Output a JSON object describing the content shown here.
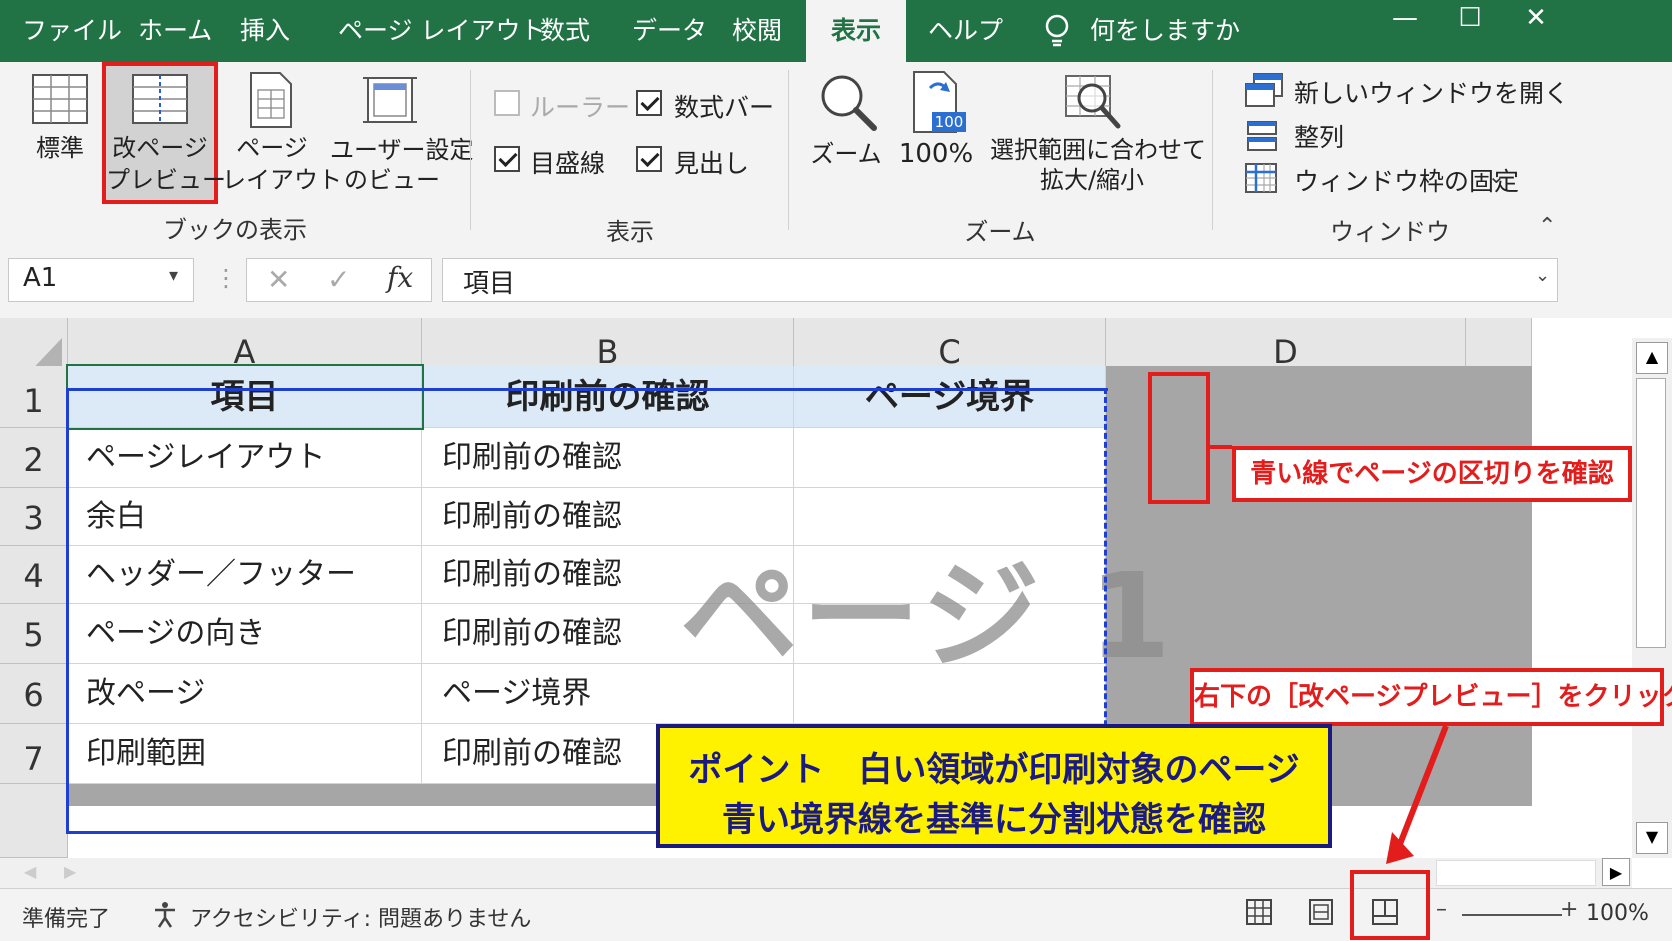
{
  "tabs": [
    "ファイル",
    "ホーム",
    "挿入",
    "ページ レイアウト",
    "数式",
    "データ",
    "校閲",
    "表示",
    "ヘルプ"
  ],
  "active_tab": "表示",
  "tell_me": "何をしますか",
  "ribbon": {
    "book_view": {
      "normal": "標準",
      "page_break_line1": "改ページ",
      "page_break_line2": "プレビュー",
      "page_layout_line1": "ページ",
      "page_layout_line2": "レイアウト",
      "custom_line1": "ユーザー設定",
      "custom_line2": "のビュー",
      "group": "ブックの表示"
    },
    "show": {
      "ruler": "ルーラー",
      "formula_bar": "数式バー",
      "gridlines": "目盛線",
      "headings": "見出し",
      "group": "表示"
    },
    "zoom": {
      "zoom": "ズーム",
      "hundred": "100%",
      "hundred_badge": "100",
      "fit_line1": "選択範囲に合わせて",
      "fit_line2": "拡大/縮小",
      "group": "ズーム"
    },
    "window": {
      "new_window": "新しいウィンドウを開く",
      "arrange": "整列",
      "freeze": "ウィンドウ枠の固定",
      "group": "ウィンドウ"
    }
  },
  "formula_bar": {
    "name_box": "A1",
    "fx": "fx",
    "value": "項目"
  },
  "columns": [
    "A",
    "B",
    "C",
    "D"
  ],
  "rows": [
    "1",
    "2",
    "3",
    "4",
    "5",
    "6",
    "7"
  ],
  "cells": [
    [
      "項目",
      "印刷前の確認",
      "ページ境界"
    ],
    [
      "ページレイアウト",
      "印刷前の確認",
      ""
    ],
    [
      "余白",
      "印刷前の確認",
      ""
    ],
    [
      "ヘッダー／フッター",
      "印刷前の確認",
      ""
    ],
    [
      "ページの向き",
      "印刷前の確認",
      ""
    ],
    [
      "改ページ",
      "ページ境界",
      ""
    ],
    [
      "印刷範囲",
      "印刷前の確認",
      ""
    ]
  ],
  "watermark": "ページ 1",
  "annotations": {
    "blue_line": "青い線でページの区切りを確認",
    "click_hint": "右下の［改ページプレビュー］をクリック",
    "point_line1": "ポイント　白い領域が印刷対象のページ",
    "point_line2": "青い境界線を基準に分割状態を確認"
  },
  "status": {
    "ready": "準備完了",
    "accessibility": "アクセシビリティ: 問題ありません",
    "zoom": "100%"
  },
  "colors": {
    "excel_green": "#217346",
    "highlight_red": "#e31c1c",
    "page_border_blue": "#1f3fcf",
    "callout_yellow": "#fff200"
  }
}
